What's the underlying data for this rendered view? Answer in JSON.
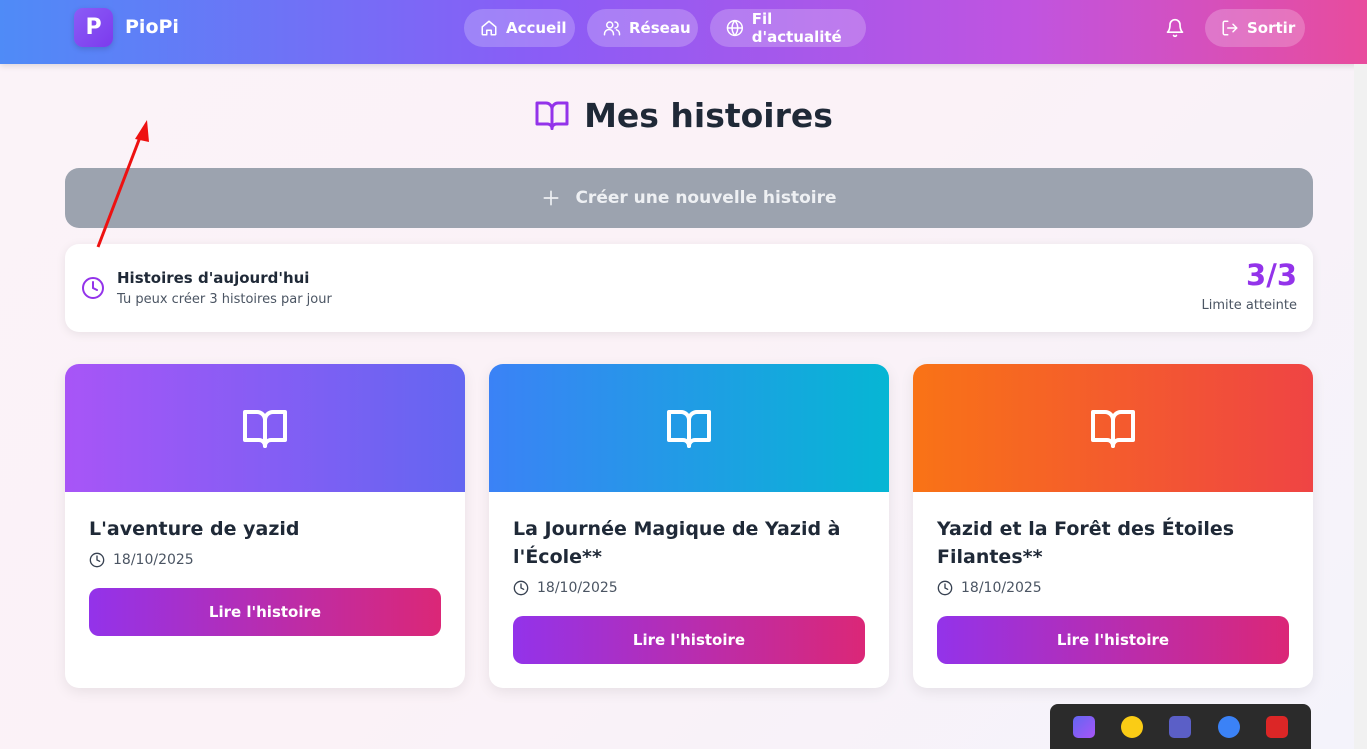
{
  "app": {
    "logo_letter": "P",
    "name": "PioPi"
  },
  "nav": [
    {
      "label": "Accueil",
      "icon": "home-icon"
    },
    {
      "label": "Réseau",
      "icon": "users-icon"
    },
    {
      "label": "Fil d'actualité",
      "icon": "globe-icon"
    }
  ],
  "header": {
    "notification_icon": "bell-icon",
    "logout_label": "Sortir"
  },
  "page": {
    "title": "Mes histoires",
    "title_icon": "book-open-icon"
  },
  "create_button": {
    "label": "Créer une nouvelle histoire",
    "icon": "plus-icon",
    "state": "disabled"
  },
  "daily_limit": {
    "title": "Histoires d'aujourd'hui",
    "subtitle": "Tu peux créer 3 histoires par jour",
    "count": "3/3",
    "status": "Limite atteinte"
  },
  "stories": [
    {
      "title": "L'aventure de yazid",
      "date": "18/10/2025",
      "button": "Lire l'histoire",
      "banner_colors": [
        "#a855f7",
        "#6366f1"
      ]
    },
    {
      "title": "La Journée Magique de Yazid à l'École**",
      "date": "18/10/2025",
      "button": "Lire l'histoire",
      "banner_colors": [
        "#3b82f6",
        "#06b6d4"
      ]
    },
    {
      "title": "Yazid et la Forêt des Étoiles Filantes**",
      "date": "18/10/2025",
      "button": "Lire l'histoire",
      "banner_colors": [
        "#f97316",
        "#ef4444"
      ]
    }
  ],
  "colors": {
    "accent_purple": "#9333ea",
    "accent_pink": "#db2777",
    "disabled_gray": "#9ca3af"
  },
  "tray_icons": [
    "app-icon-1",
    "app-icon-2",
    "teams-icon",
    "app-icon-4",
    "mcafee-icon"
  ]
}
